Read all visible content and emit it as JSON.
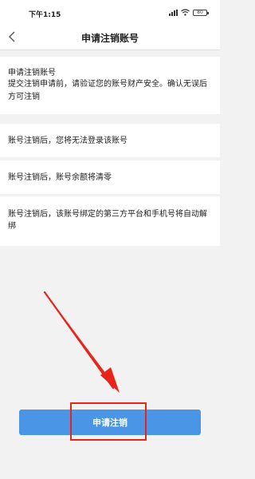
{
  "status_bar": {
    "time": "下午1:15",
    "battery": "80",
    "icons": [
      "signal-icon",
      "wifi-icon",
      "battery-icon"
    ]
  },
  "nav": {
    "title": "申请注销账号",
    "back_icon": "chevron-left-icon"
  },
  "intro": {
    "title": "申请注销账号",
    "description": "提交注销申请前，请验证您的账号财产安全。确认无误后方可注销"
  },
  "notices": [
    "账号注销后，您将无法登录该账号",
    "账号注销后，账号余额将清零",
    "账号注销后，该账号绑定的第三方平台和手机号将自动解绑"
  ],
  "action": {
    "button_label": "申请注销"
  },
  "colors": {
    "primary_button": "#4a95e6",
    "annotation_red": "#e8231a",
    "background": "#f2f2f2"
  }
}
